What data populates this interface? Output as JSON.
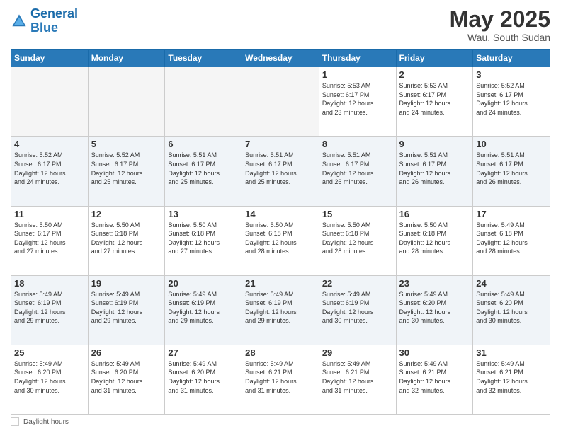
{
  "header": {
    "logo_line1": "General",
    "logo_line2": "Blue",
    "month_year": "May 2025",
    "location": "Wau, South Sudan"
  },
  "weekdays": [
    "Sunday",
    "Monday",
    "Tuesday",
    "Wednesday",
    "Thursday",
    "Friday",
    "Saturday"
  ],
  "footer": {
    "daylight_label": "Daylight hours"
  },
  "weeks": [
    [
      {
        "day": "",
        "info": ""
      },
      {
        "day": "",
        "info": ""
      },
      {
        "day": "",
        "info": ""
      },
      {
        "day": "",
        "info": ""
      },
      {
        "day": "1",
        "info": "Sunrise: 5:53 AM\nSunset: 6:17 PM\nDaylight: 12 hours\nand 23 minutes."
      },
      {
        "day": "2",
        "info": "Sunrise: 5:53 AM\nSunset: 6:17 PM\nDaylight: 12 hours\nand 24 minutes."
      },
      {
        "day": "3",
        "info": "Sunrise: 5:52 AM\nSunset: 6:17 PM\nDaylight: 12 hours\nand 24 minutes."
      }
    ],
    [
      {
        "day": "4",
        "info": "Sunrise: 5:52 AM\nSunset: 6:17 PM\nDaylight: 12 hours\nand 24 minutes."
      },
      {
        "day": "5",
        "info": "Sunrise: 5:52 AM\nSunset: 6:17 PM\nDaylight: 12 hours\nand 25 minutes."
      },
      {
        "day": "6",
        "info": "Sunrise: 5:51 AM\nSunset: 6:17 PM\nDaylight: 12 hours\nand 25 minutes."
      },
      {
        "day": "7",
        "info": "Sunrise: 5:51 AM\nSunset: 6:17 PM\nDaylight: 12 hours\nand 25 minutes."
      },
      {
        "day": "8",
        "info": "Sunrise: 5:51 AM\nSunset: 6:17 PM\nDaylight: 12 hours\nand 26 minutes."
      },
      {
        "day": "9",
        "info": "Sunrise: 5:51 AM\nSunset: 6:17 PM\nDaylight: 12 hours\nand 26 minutes."
      },
      {
        "day": "10",
        "info": "Sunrise: 5:51 AM\nSunset: 6:17 PM\nDaylight: 12 hours\nand 26 minutes."
      }
    ],
    [
      {
        "day": "11",
        "info": "Sunrise: 5:50 AM\nSunset: 6:17 PM\nDaylight: 12 hours\nand 27 minutes."
      },
      {
        "day": "12",
        "info": "Sunrise: 5:50 AM\nSunset: 6:18 PM\nDaylight: 12 hours\nand 27 minutes."
      },
      {
        "day": "13",
        "info": "Sunrise: 5:50 AM\nSunset: 6:18 PM\nDaylight: 12 hours\nand 27 minutes."
      },
      {
        "day": "14",
        "info": "Sunrise: 5:50 AM\nSunset: 6:18 PM\nDaylight: 12 hours\nand 28 minutes."
      },
      {
        "day": "15",
        "info": "Sunrise: 5:50 AM\nSunset: 6:18 PM\nDaylight: 12 hours\nand 28 minutes."
      },
      {
        "day": "16",
        "info": "Sunrise: 5:50 AM\nSunset: 6:18 PM\nDaylight: 12 hours\nand 28 minutes."
      },
      {
        "day": "17",
        "info": "Sunrise: 5:49 AM\nSunset: 6:18 PM\nDaylight: 12 hours\nand 28 minutes."
      }
    ],
    [
      {
        "day": "18",
        "info": "Sunrise: 5:49 AM\nSunset: 6:19 PM\nDaylight: 12 hours\nand 29 minutes."
      },
      {
        "day": "19",
        "info": "Sunrise: 5:49 AM\nSunset: 6:19 PM\nDaylight: 12 hours\nand 29 minutes."
      },
      {
        "day": "20",
        "info": "Sunrise: 5:49 AM\nSunset: 6:19 PM\nDaylight: 12 hours\nand 29 minutes."
      },
      {
        "day": "21",
        "info": "Sunrise: 5:49 AM\nSunset: 6:19 PM\nDaylight: 12 hours\nand 29 minutes."
      },
      {
        "day": "22",
        "info": "Sunrise: 5:49 AM\nSunset: 6:19 PM\nDaylight: 12 hours\nand 30 minutes."
      },
      {
        "day": "23",
        "info": "Sunrise: 5:49 AM\nSunset: 6:20 PM\nDaylight: 12 hours\nand 30 minutes."
      },
      {
        "day": "24",
        "info": "Sunrise: 5:49 AM\nSunset: 6:20 PM\nDaylight: 12 hours\nand 30 minutes."
      }
    ],
    [
      {
        "day": "25",
        "info": "Sunrise: 5:49 AM\nSunset: 6:20 PM\nDaylight: 12 hours\nand 30 minutes."
      },
      {
        "day": "26",
        "info": "Sunrise: 5:49 AM\nSunset: 6:20 PM\nDaylight: 12 hours\nand 31 minutes."
      },
      {
        "day": "27",
        "info": "Sunrise: 5:49 AM\nSunset: 6:20 PM\nDaylight: 12 hours\nand 31 minutes."
      },
      {
        "day": "28",
        "info": "Sunrise: 5:49 AM\nSunset: 6:21 PM\nDaylight: 12 hours\nand 31 minutes."
      },
      {
        "day": "29",
        "info": "Sunrise: 5:49 AM\nSunset: 6:21 PM\nDaylight: 12 hours\nand 31 minutes."
      },
      {
        "day": "30",
        "info": "Sunrise: 5:49 AM\nSunset: 6:21 PM\nDaylight: 12 hours\nand 32 minutes."
      },
      {
        "day": "31",
        "info": "Sunrise: 5:49 AM\nSunset: 6:21 PM\nDaylight: 12 hours\nand 32 minutes."
      }
    ]
  ]
}
